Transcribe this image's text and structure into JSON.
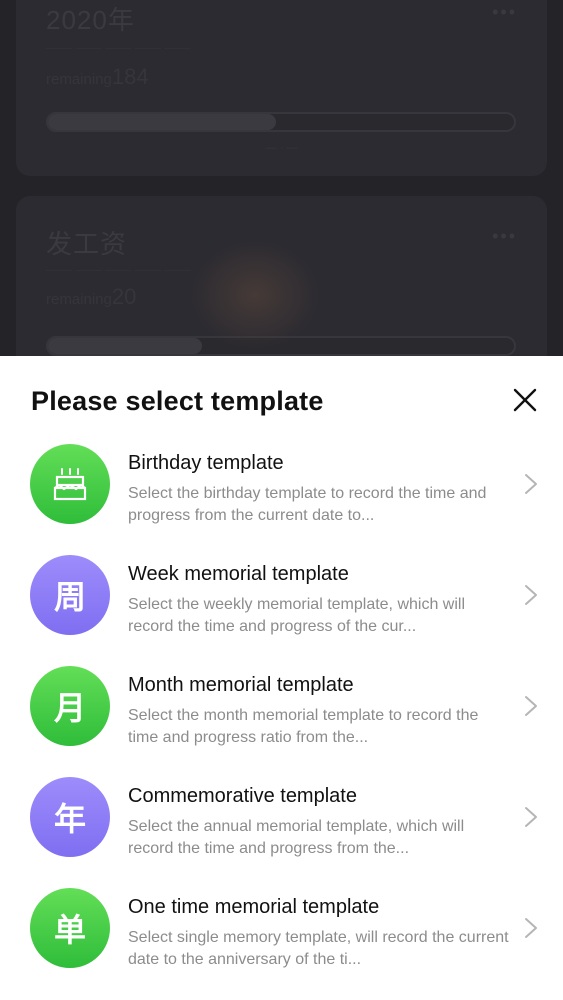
{
  "background": {
    "cards": [
      {
        "title": "2020年",
        "remaining_label": "remaining",
        "remaining_value": "184",
        "progress_fraction": 0.49
      },
      {
        "title": "发工资",
        "remaining_label": "remaining",
        "remaining_value": "20",
        "progress_fraction": 0.33
      }
    ]
  },
  "sheet": {
    "title": "Please select template",
    "close_icon": "close-icon",
    "items": [
      {
        "icon_glyph": "birthday-cake-icon",
        "icon_color": "#3fc947",
        "title": "Birthday template",
        "description": "Select the birthday template to record the time and progress from the current date to..."
      },
      {
        "icon_glyph": "周",
        "icon_color": "#8b7bf6",
        "title": "Week memorial template",
        "description": "Select the weekly memorial template, which will record the time and progress of the cur..."
      },
      {
        "icon_glyph": "月",
        "icon_color": "#3fc947",
        "title": "Month memorial template",
        "description": "Select the month memorial template to record the time and progress ratio from the..."
      },
      {
        "icon_glyph": "年",
        "icon_color": "#8b7bf6",
        "title": "Commemorative template",
        "description": "Select the annual memorial template, which will record the time and progress from the..."
      },
      {
        "icon_glyph": "单",
        "icon_color": "#3fc947",
        "title": "One time memorial template",
        "description": "Select single memory template, will record the current date to the anniversary of the ti..."
      }
    ]
  }
}
